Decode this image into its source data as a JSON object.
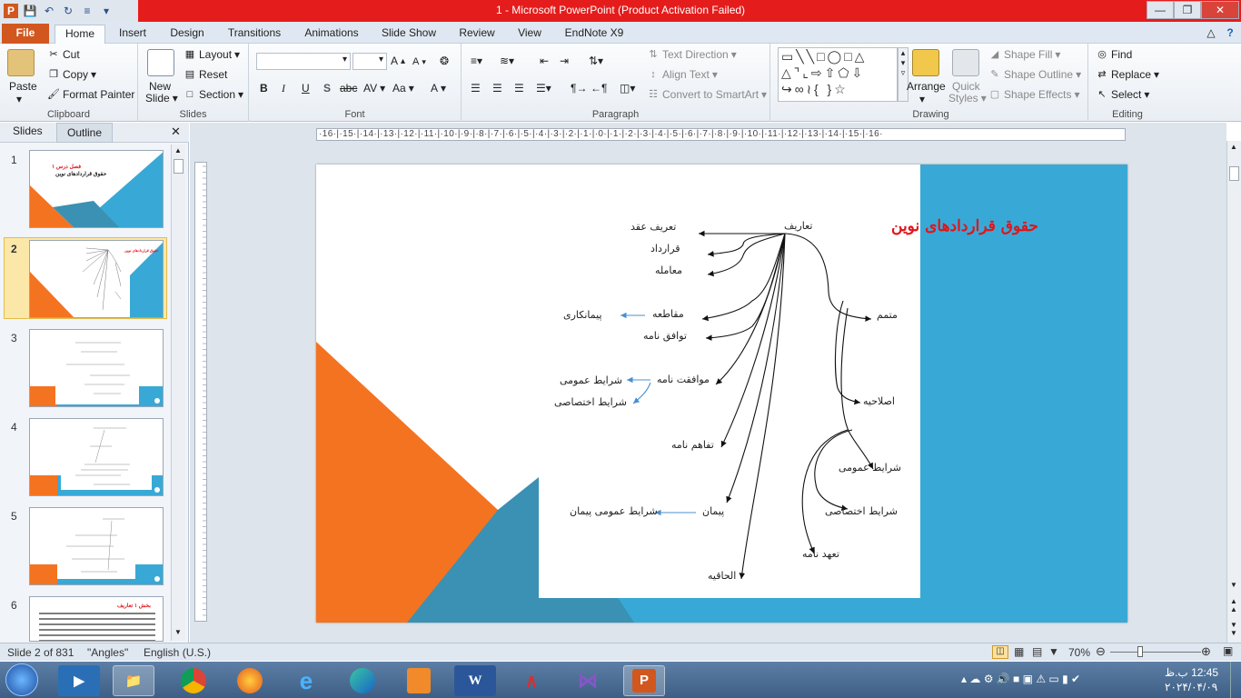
{
  "window": {
    "title": "1  -  Microsoft PowerPoint (Product Activation Failed)"
  },
  "tabs": [
    "File",
    "Home",
    "Insert",
    "Design",
    "Transitions",
    "Animations",
    "Slide Show",
    "Review",
    "View",
    "EndNote X9"
  ],
  "ribbon": {
    "clipboard": {
      "label": "Clipboard",
      "paste": "Paste",
      "cut": "Cut",
      "copy": "Copy",
      "format_painter": "Format Painter"
    },
    "slides": {
      "label": "Slides",
      "new_slide_1": "New",
      "new_slide_2": "Slide",
      "layout": "Layout",
      "reset": "Reset",
      "section": "Section"
    },
    "font": {
      "label": "Font",
      "bold": "B",
      "italic": "I",
      "underline": "U",
      "strike": "S",
      "abc": "abc",
      "av": "AV",
      "aa": "Aa",
      "a": "A"
    },
    "paragraph": {
      "label": "Paragraph",
      "text_direction": "Text Direction",
      "align_text": "Align Text",
      "convert_smartart": "Convert to SmartArt"
    },
    "drawing": {
      "label": "Drawing",
      "arrange": "Arrange",
      "quick_styles_1": "Quick",
      "quick_styles_2": "Styles",
      "shape_fill": "Shape Fill",
      "shape_outline": "Shape Outline",
      "shape_effects": "Shape Effects"
    },
    "editing": {
      "label": "Editing",
      "find": "Find",
      "replace": "Replace",
      "select": "Select"
    }
  },
  "left_pane": {
    "tab_slides": "Slides",
    "tab_outline": "Outline",
    "slide_numbers": [
      "1",
      "2",
      "3",
      "4",
      "5",
      "6"
    ]
  },
  "ruler": {
    "h_text": "·16·|·15·|·14·|·13·|·12·|·11·|·10·|·9·|·8·|·7·|·6·|·5·|·4·|·3·|·2·|·1·|·0·|·1·|·2·|·3·|·4·|·5·|·6·|·7·|·8·|·9·|·10·|·11·|·12·|·13·|·14·|·15·|·16·"
  },
  "slide": {
    "title": "حقوق قراردادهای نوین",
    "nodes": {
      "root": "تعاریف",
      "tarif_aqd": "تعریف عقد",
      "qarardad": "قرارداد",
      "moameleh": "معامله",
      "moqateeh": "مقاطعه",
      "peymankari": "پیمانکاری",
      "tavafoq": "توافق نامه",
      "movafeqat": "موافقت نامه",
      "sharayet_omumi_1": "شرایط عمومی",
      "sharayet_ekhtesasi_1": "شرایط اختصاصی",
      "tafahom": "تفاهم نامه",
      "peyman": "پیمان",
      "sharayet_omumi_peyman": "شرایط عمومی پیمان",
      "elhaqieh": "الحاقیه",
      "motamem": "متمم",
      "eslahieh": "اصلاحیه",
      "sharayet_omumi_2": "شرایط عمومی",
      "sharayet_ekhtesasi_2": "شرایط اختصاصی",
      "tahodnameh": "تعهد نامه"
    }
  },
  "thumbs": {
    "t1_line1": "فصل درس ۱",
    "t1_line2": "حقوق قراردادهای نوین",
    "t6_title": "بخش ۱ تعاریف"
  },
  "status": {
    "slide_info": "Slide 2 of 831",
    "theme": "\"Angles\"",
    "language": "English (U.S.)",
    "zoom": "70%"
  },
  "taskbar": {
    "time": "12:45 ب.ظ",
    "date": "۲۰۲۴/۰۴/۰۹"
  },
  "colors": {
    "orange": "#f47321",
    "blue": "#38a9d6",
    "darkblue": "#3a91b3",
    "title_red": "#e2141b"
  }
}
